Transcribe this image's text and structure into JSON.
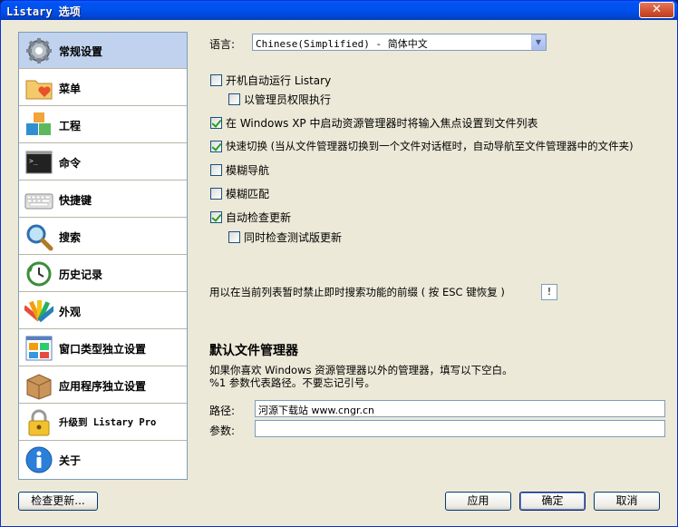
{
  "window": {
    "title": "Listary 选项",
    "close_glyph": "✕"
  },
  "sidebar": {
    "items": [
      {
        "label": "常规设置",
        "icon": "gear-icon"
      },
      {
        "label": "菜单",
        "icon": "folder-heart-icon"
      },
      {
        "label": "工程",
        "icon": "blocks-icon"
      },
      {
        "label": "命令",
        "icon": "terminal-icon"
      },
      {
        "label": "快捷键",
        "icon": "keyboard-icon"
      },
      {
        "label": "搜索",
        "icon": "magnifier-icon"
      },
      {
        "label": "历史记录",
        "icon": "history-clock-icon"
      },
      {
        "label": "外观",
        "icon": "palette-icon"
      },
      {
        "label": "窗口类型独立设置",
        "icon": "window-grid-icon"
      },
      {
        "label": "应用程序独立设置",
        "icon": "box-icon"
      },
      {
        "label": "升级到 Listary Pro",
        "icon": "lock-icon"
      },
      {
        "label": "关于",
        "icon": "info-icon"
      }
    ]
  },
  "general": {
    "language_label": "语言:",
    "language_value": "Chinese(Simplified) - 简体中文",
    "options": [
      {
        "label": "开机自动运行 Listary",
        "checked": false
      },
      {
        "label": "以管理员权限执行",
        "checked": false
      },
      {
        "label": "在 Windows XP 中启动资源管理器时将输入焦点设置到文件列表",
        "checked": true
      },
      {
        "label": "快速切换 (当从文件管理器切换到一个文件对话框时，自动导航至文件管理器中的文件夹)",
        "checked": true
      },
      {
        "label": "模糊导航",
        "checked": false
      },
      {
        "label": "模糊匹配",
        "checked": false
      },
      {
        "label": "自动检查更新",
        "checked": true
      },
      {
        "label": "同时检查测试版更新",
        "checked": false
      }
    ],
    "prefix_text": "用以在当前列表暂时禁止即时搜索功能的前缀 ( 按 ESC 键恢复 )",
    "prefix_value": "!"
  },
  "file_manager": {
    "title": "默认文件管理器",
    "desc_line1": "如果你喜欢 Windows 资源管理器以外的管理器，填写以下空白。",
    "desc_line2": "%1 参数代表路径。不要忘记引号。",
    "path_label": "路径:",
    "path_value": "河源下载站 www.cngr.cn",
    "args_label": "参数:",
    "args_value": ""
  },
  "buttons": {
    "check_update": "检查更新...",
    "apply": "应用",
    "ok": "确定",
    "cancel": "取消"
  },
  "colors": {
    "title_bar": "#0054e3",
    "selected_item": "#c1d2ee",
    "window_bg": "#ece9d8"
  }
}
